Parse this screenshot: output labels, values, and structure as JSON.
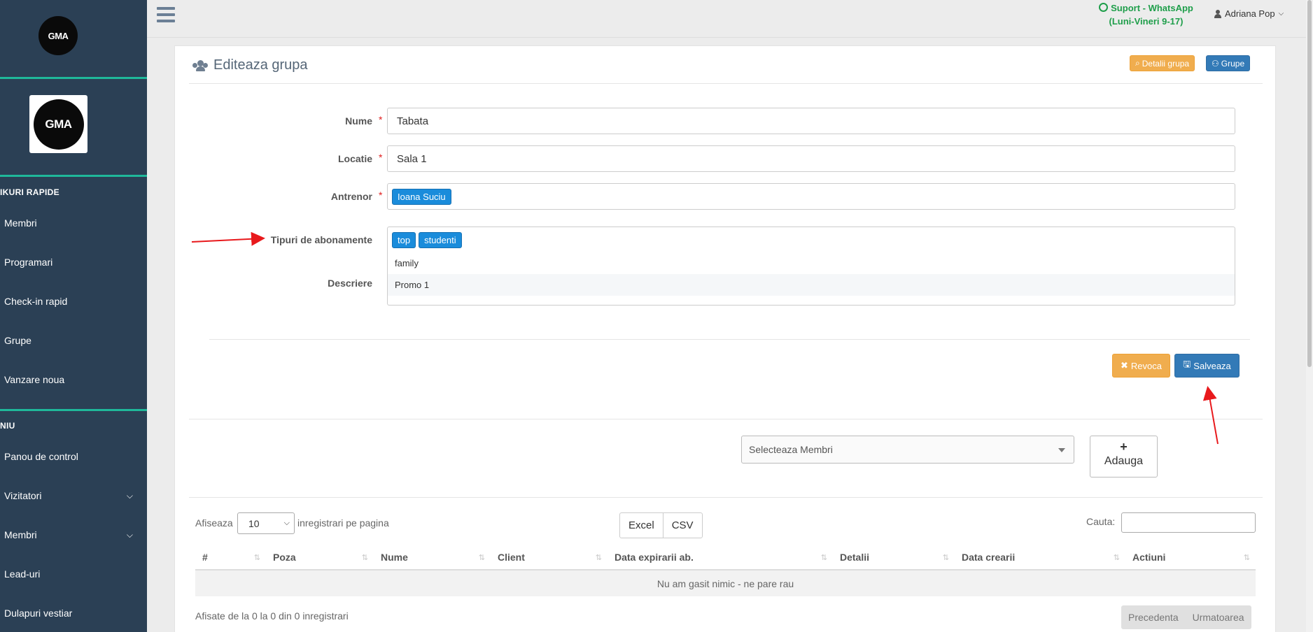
{
  "sidebar": {
    "section_shortcuts": "IKURI RAPIDE",
    "shortcuts": [
      {
        "label": "Membri"
      },
      {
        "label": "Programari"
      },
      {
        "label": "Check-in rapid"
      },
      {
        "label": "Grupe"
      },
      {
        "label": "Vanzare noua"
      }
    ],
    "section_menu": "NIU",
    "menu": [
      {
        "label": "Panou de control"
      },
      {
        "label": "Vizitatori"
      },
      {
        "label": "Membri"
      },
      {
        "label": "Lead-uri"
      },
      {
        "label": "Dulapuri vestiar"
      }
    ],
    "logo_text": "GMA"
  },
  "topbar": {
    "support_line1": "Suport - WhatsApp",
    "support_line2": "(Luni-Vineri 9-17)",
    "user_name": "Adriana Pop"
  },
  "panel": {
    "title": "Editeaza grupa",
    "details_button": "Detalii grupa",
    "groups_button": "Grupe"
  },
  "form": {
    "name_label": "Nume",
    "name_value": "Tabata",
    "location_label": "Locatie",
    "location_value": "Sala 1",
    "trainer_label": "Antrenor",
    "trainer_tag": "Ioana Suciu",
    "subs_label": "Tipuri de abonamente",
    "subs_tags": [
      "top",
      "studenti"
    ],
    "subs_options": [
      "family",
      "Promo 1"
    ],
    "description_label": "Descriere",
    "revoke_button": "Revoca",
    "save_button": "Salveaza"
  },
  "members": {
    "select_placeholder": "Selecteaza Membri",
    "add_button": "Adauga"
  },
  "table": {
    "show_label": "Afiseaza",
    "page_length": "10",
    "per_page_label": "inregistrari pe pagina",
    "export_buttons": [
      "Excel",
      "CSV"
    ],
    "search_label": "Cauta:",
    "columns": [
      "#",
      "Poza",
      "Nume",
      "Client",
      "Data expirarii ab.",
      "Detalii",
      "Data crearii",
      "Actiuni"
    ],
    "empty_message": "Nu am gasit nimic - ne pare rau",
    "info": "Afisate de la 0 la 0 din 0 inregistrari",
    "prev": "Precedenta",
    "next": "Urmatoarea"
  },
  "colors": {
    "sidebar_bg": "#2b4055",
    "accent_teal": "#1fb89a",
    "btn_orange": "#f0ad4e",
    "btn_blue": "#337ab7",
    "tag_blue": "#1a8cdb",
    "whatsapp_green": "#1e9e4a",
    "annotation_red": "#e8191c"
  }
}
